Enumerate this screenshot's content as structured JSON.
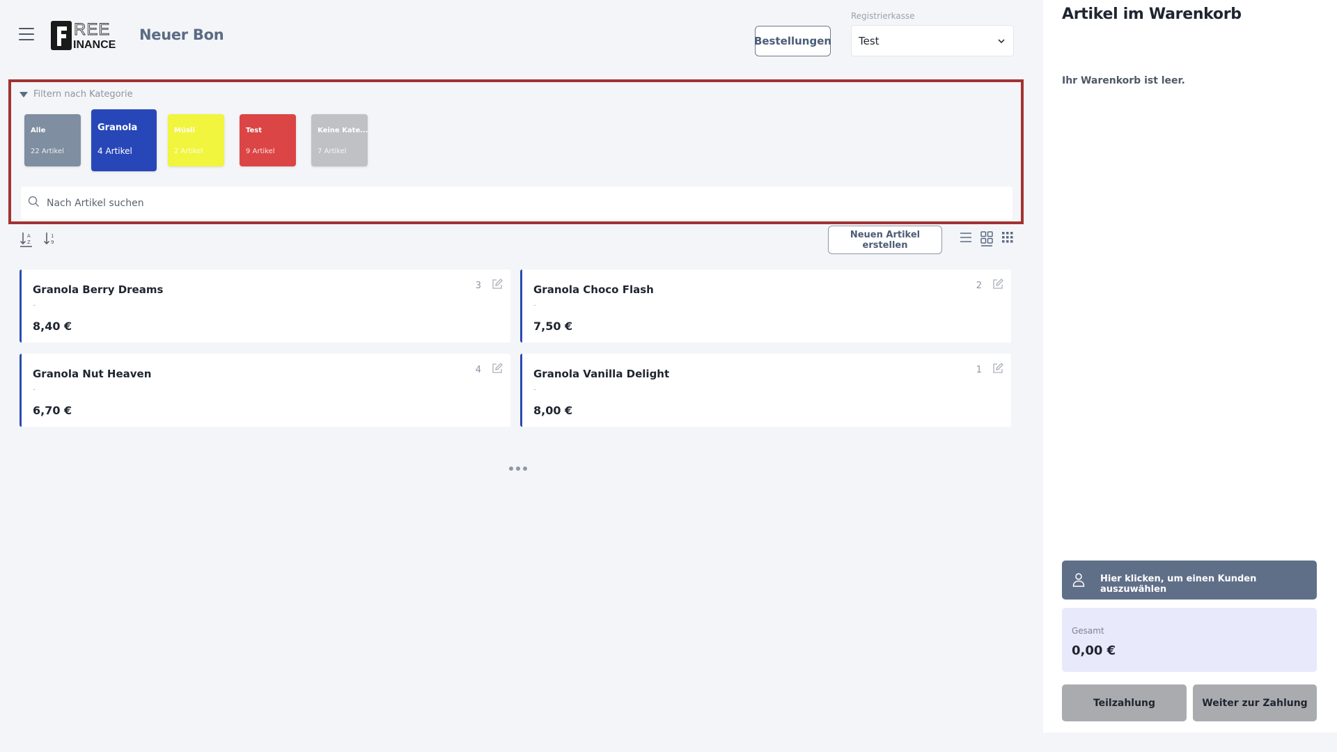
{
  "header": {
    "page_title": "Neuer Bon",
    "orders_button": "Bestellungen",
    "register_label": "Registrierkasse",
    "register_value": "Test"
  },
  "filter": {
    "toggle_label": "Filtern nach Kategorie",
    "categories": [
      {
        "name": "Alle",
        "count": "22 Artikel",
        "color": "#7f8ea0",
        "text_color": "#ffffff"
      },
      {
        "name": "Granola",
        "count": "4 Artikel",
        "color": "#2747b8",
        "text_color": "#ffffff"
      },
      {
        "name": "Müsli",
        "count": "2 Artikel",
        "color": "#f1f53d",
        "text_color": "#ffffff"
      },
      {
        "name": "Test",
        "count": "9 Artikel",
        "color": "#db4545",
        "text_color": "#ffffff"
      },
      {
        "name": "Keine Kate...",
        "count": "7 Artikel",
        "color": "#bfc1c4",
        "text_color": "#ffffff"
      }
    ],
    "search_placeholder": "Nach Artikel suchen"
  },
  "toolbar": {
    "new_item_button": "Neuen Artikel erstellen"
  },
  "products": [
    {
      "name": "Granola Berry Dreams",
      "description": "-",
      "price": "8,40 €",
      "stock": "3"
    },
    {
      "name": "Granola Choco Flash",
      "description": "-",
      "price": "7,50 €",
      "stock": "2"
    },
    {
      "name": "Granola Nut Heaven",
      "description": "-",
      "price": "6,70 €",
      "stock": "4"
    },
    {
      "name": "Granola Vanilla Delight",
      "description": "-",
      "price": "8,00 €",
      "stock": "1"
    }
  ],
  "cart": {
    "title": "Artikel im Warenkorb",
    "empty_text": "Ihr Warenkorb ist leer.",
    "customer_button": "Hier klicken, um einen Kunden auszuwählen",
    "total_label": "Gesamt",
    "total_value": "0,00 €",
    "partial_payment_button": "Teilzahlung",
    "continue_payment_button": "Weiter zur Zahlung"
  },
  "icons": {
    "menu": "hamburger-icon",
    "search": "search-icon",
    "sort_asc": "sort-alpha-asc-icon",
    "sort_num": "sort-numeric-icon",
    "list_view": "list-view-icon",
    "grid_view": "grid-view-icon",
    "compact_grid_view": "compact-grid-icon",
    "edit": "edit-icon",
    "user": "user-icon",
    "more": "more-dots-icon"
  }
}
